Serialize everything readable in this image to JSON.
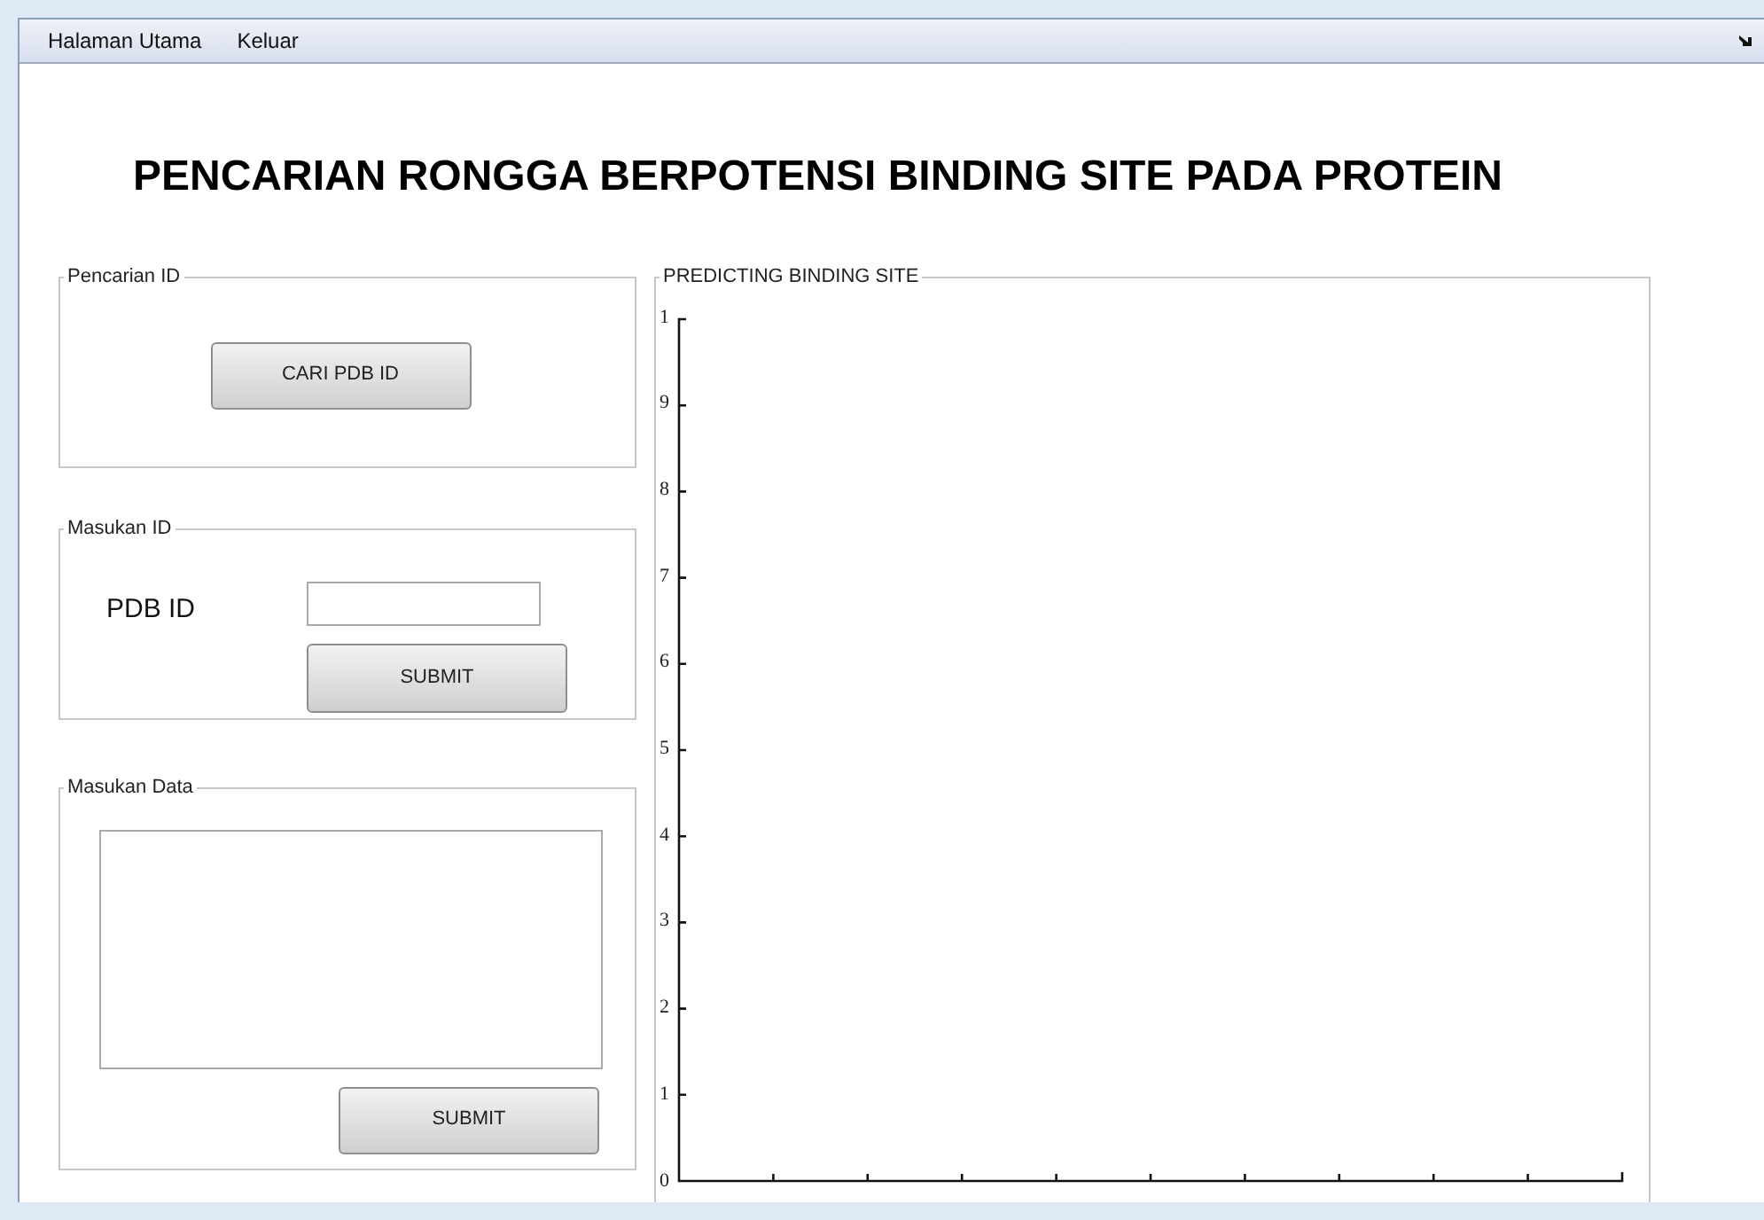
{
  "menu": [
    {
      "label": "Halaman Utama"
    },
    {
      "label": "Keluar"
    }
  ],
  "title": "PENCARIAN RONGGA BERPOTENSI BINDING SITE PADA PROTEIN",
  "search_panel": {
    "legend": "Pencarian ID",
    "button": "CARI PDB ID"
  },
  "id_panel": {
    "legend": "Masukan ID",
    "label": "PDB ID",
    "button": "SUBMIT"
  },
  "data_panel": {
    "legend": "Masukan Data",
    "button": "SUBMIT"
  },
  "plot_panel": {
    "legend": "PREDICTING BINDING SITE",
    "y_tick_labels": [
      "1",
      "9",
      "8",
      "7",
      "6",
      "5",
      "4",
      "3",
      "2",
      "1",
      "0"
    ]
  }
}
